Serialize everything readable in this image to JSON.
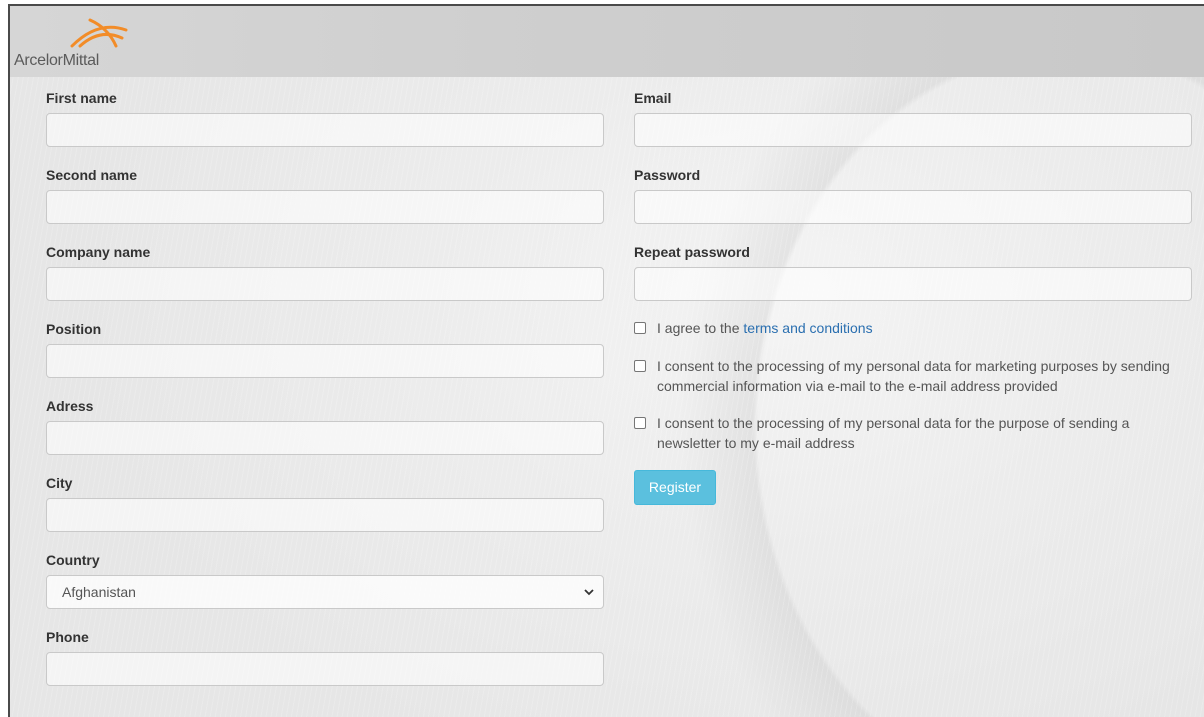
{
  "brand": {
    "name": "ArcelorMittal",
    "logo_color": "#f28c28",
    "icon": "arcelormittal-logo-icon"
  },
  "form": {
    "left": {
      "first_name_label": "First name",
      "second_name_label": "Second name",
      "company_name_label": "Company name",
      "position_label": "Position",
      "address_label": "Adress",
      "city_label": "City",
      "country_label": "Country",
      "country_value": "Afghanistan",
      "phone_label": "Phone"
    },
    "right": {
      "email_label": "Email",
      "password_label": "Password",
      "repeat_password_label": "Repeat password",
      "terms_prefix": "I agree to the",
      "terms_link": "terms and conditions",
      "marketing_consent": "I consent to the processing of my personal data for marketing purposes by sending commercial information via e-mail to the e-mail address provided",
      "newsletter_consent": "I consent to the processing of my personal data for the purpose of sending a newsletter to my e-mail address",
      "register_label": "Register"
    }
  },
  "colors": {
    "register_button": "#5bc0de",
    "link": "#2a6fb0"
  }
}
